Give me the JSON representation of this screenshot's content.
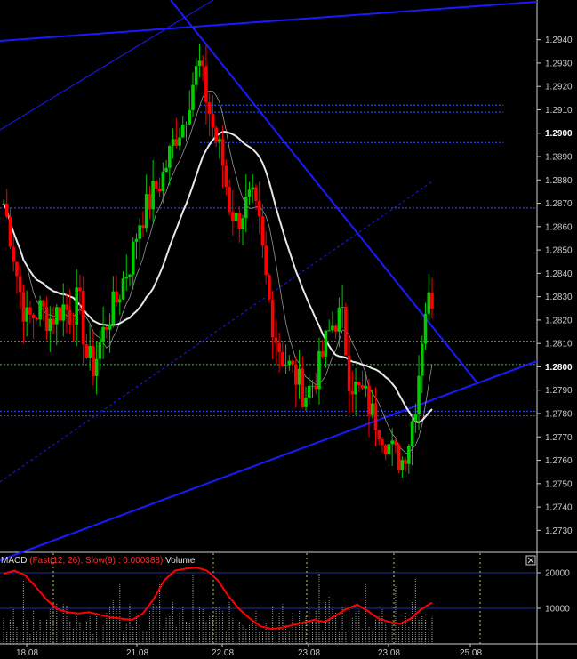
{
  "chart_data": [
    {
      "type": "candlestick",
      "title": "",
      "y_axis": {
        "position": "right",
        "ylim": [
          1.2721,
          1.2957
        ],
        "ticks": [
          "1.2730",
          "1.2740",
          "1.2750",
          "1.2760",
          "1.2770",
          "1.2780",
          "1.2790",
          "1.2800",
          "1.2810",
          "1.2820",
          "1.2830",
          "1.2840",
          "1.2850",
          "1.2860",
          "1.2870",
          "1.2880",
          "1.2890",
          "1.2900",
          "1.2910",
          "1.2920",
          "1.2930",
          "1.2940"
        ],
        "bold_ticks": [
          "1.2800",
          "1.2900"
        ]
      },
      "x_axis": {
        "ticks": [
          "18.08",
          "21.08",
          "22.08",
          "23.08",
          "23.08",
          "25.08"
        ]
      },
      "colors": {
        "up": "#00cc00",
        "down": "#ff0000",
        "background": "#000000",
        "trendline": "#1a1aff",
        "ma_slow": "#e8e8e8",
        "ma_fast": "#bdbdbd"
      },
      "series_description": "Approx. 130 bars drifting up from ~1.2820 to a peak near 1.2935 on 21.08/22.08, then falling to ~1.2760 on 23.08 before a sharp rebound to ~1.2830.",
      "anchor_closes": [
        1.287,
        1.2855,
        1.2835,
        1.282,
        1.2822,
        1.2825,
        1.282,
        1.2823,
        1.2826,
        1.2822,
        1.283,
        1.2805,
        1.28,
        1.2812,
        1.2822,
        1.2828,
        1.2838,
        1.2846,
        1.2862,
        1.2868,
        1.2875,
        1.288,
        1.289,
        1.29,
        1.2905,
        1.292,
        1.293,
        1.2915,
        1.29,
        1.289,
        1.287,
        1.2862,
        1.2868,
        1.2872,
        1.286,
        1.2835,
        1.2815,
        1.2805,
        1.28,
        1.2795,
        1.2788,
        1.2792,
        1.28,
        1.2812,
        1.282,
        1.2822,
        1.2795,
        1.279,
        1.2788,
        1.278,
        1.2775,
        1.2768,
        1.2762,
        1.276,
        1.277,
        1.279,
        1.2825,
        1.283
      ],
      "horizontal_levels": [
        {
          "value": 1.2811,
          "color": "#ff3030",
          "style": "dotted"
        },
        {
          "value": 1.2801,
          "color": "#30c030",
          "style": "dotted"
        },
        {
          "value": 1.2912,
          "color": "#3050ff",
          "style": "dotted"
        },
        {
          "value": 1.2909,
          "color": "#3050ff",
          "style": "dotted"
        },
        {
          "value": 1.2896,
          "color": "#3050ff",
          "style": "dotted"
        },
        {
          "value": 1.2868,
          "color": "#3050ff",
          "style": "dotted"
        },
        {
          "value": 1.2781,
          "color": "#3050ff",
          "style": "dotted"
        },
        {
          "value": 1.2779,
          "color": "#3050ff",
          "style": "dotted"
        }
      ]
    },
    {
      "type": "indicator",
      "label": "MACD (Fast(12, 26), Slow(9) : 0.000388)",
      "label_macd": "MACD",
      "label_params": "(Fast(12, 26), Slow(9) : 0.000388)",
      "label_volume": "Volume",
      "close_button": "×",
      "y_axis": {
        "ticks": [
          "20000",
          "10000"
        ],
        "ylim": [
          0,
          24000
        ]
      },
      "volume_color": "#33dd33",
      "macd_color": "#ff0000",
      "macd_values": [
        0.9,
        0.95,
        0.88,
        0.7,
        0.5,
        0.35,
        0.3,
        0.28,
        0.3,
        0.26,
        0.22,
        0.2,
        0.18,
        0.28,
        0.5,
        0.8,
        0.95,
        0.98,
        1.0,
        0.95,
        0.8,
        0.55,
        0.35,
        0.2,
        0.08,
        0.04,
        0.06,
        0.1,
        0.14,
        0.18,
        0.15,
        0.25,
        0.35,
        0.42,
        0.32,
        0.2,
        0.15,
        0.12,
        0.2,
        0.35,
        0.45
      ]
    }
  ]
}
